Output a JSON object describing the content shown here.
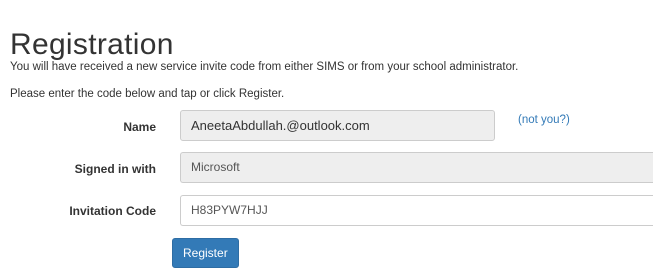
{
  "page": {
    "title": "Registration",
    "intro_line_1": "You will have received a new service invite code from either SIMS or from your school administrator.",
    "intro_line_2": "Please enter the code below and tap or click Register."
  },
  "form": {
    "name": {
      "label": "Name",
      "value": "AneetaAbdullah.@outlook.com",
      "not_you_link": "(not you?)"
    },
    "signed_in_with": {
      "label": "Signed in with",
      "value": "Microsoft"
    },
    "invitation_code": {
      "label": "Invitation Code",
      "value": "H83PYW7HJJ"
    },
    "register_button": "Register"
  },
  "colors": {
    "accent": "#337ab7",
    "readonly_bg": "#eeeeee",
    "text": "#333333"
  }
}
